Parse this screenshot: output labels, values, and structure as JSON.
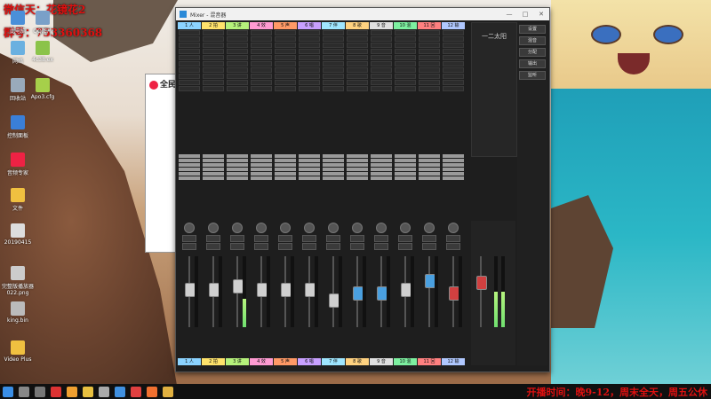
{
  "overlay": {
    "line1": "微信天：花镜花2",
    "line2": "群号：753360368"
  },
  "desktop_icons": [
    {
      "label": "此电脑"
    },
    {
      "label": "QQ图片"
    },
    {
      "label": "网络"
    },
    {
      "label": "4c38.ex"
    },
    {
      "label": "回收站"
    },
    {
      "label": "Apo3.cfg"
    },
    {
      "label": "控制面板"
    },
    {
      "label": "音频专家"
    },
    {
      "label": "文件"
    },
    {
      "label": "20190415"
    },
    {
      "label": "完整版播放器022.png"
    },
    {
      "label": "king.bin"
    },
    {
      "label": "Video Plus"
    }
  ],
  "background_window": {
    "title": "全民K"
  },
  "mixer": {
    "title": "Mixer - 混音器",
    "right_title": "一二太阳",
    "tracks": [
      {
        "label": "1 人",
        "color": "#8bd3ff"
      },
      {
        "label": "2 拍",
        "color": "#ffe36b"
      },
      {
        "label": "3 讲",
        "color": "#b6f27b"
      },
      {
        "label": "4 效",
        "color": "#ff9bd2"
      },
      {
        "label": "5 声",
        "color": "#ff9966"
      },
      {
        "label": "6 唱",
        "color": "#c8a0ff"
      },
      {
        "label": "7 伴",
        "color": "#9fe6ff"
      },
      {
        "label": "8 歌",
        "color": "#ffd280"
      },
      {
        "label": "9 音",
        "color": "#e0e0e0"
      },
      {
        "label": "10 混",
        "color": "#7df0a0"
      },
      {
        "label": "11 回",
        "color": "#ff8080"
      },
      {
        "label": "12 输",
        "color": "#b0c8ff"
      }
    ],
    "side_buttons": [
      "设置",
      "混音",
      "分配",
      "输出",
      "监听"
    ]
  },
  "taskbar": {
    "ticker": "开播时间：晚9-12，周末全天，周五公休"
  }
}
